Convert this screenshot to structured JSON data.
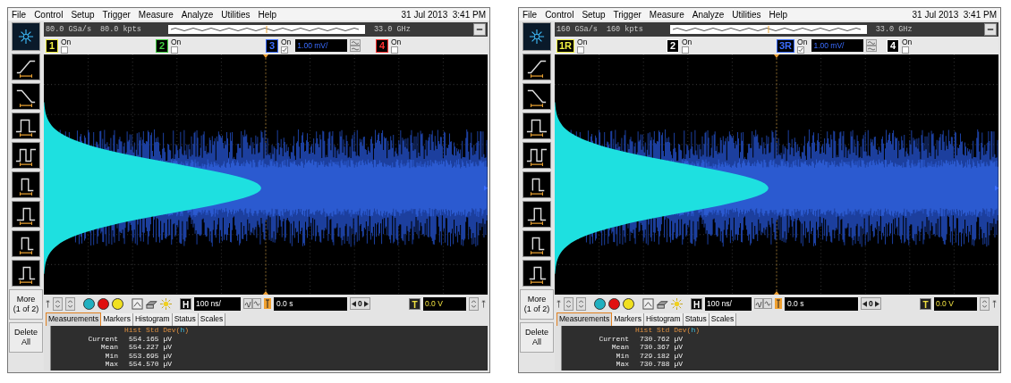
{
  "scopes": [
    {
      "menu": [
        "File",
        "Control",
        "Setup",
        "Trigger",
        "Measure",
        "Analyze",
        "Utilities",
        "Help"
      ],
      "datetime": "31 Jul 2013  3:41 PM",
      "sample_rate": "80.0 GSa/s",
      "memory": "80.0 kpts",
      "bandwidth": "33.0 GHz",
      "channels": [
        {
          "label": "1",
          "status": "On",
          "checked": false,
          "color": "#f0f040"
        },
        {
          "label": "2",
          "status": "On",
          "checked": false,
          "color": "#40d040"
        },
        {
          "label": "3",
          "status": "On",
          "checked": true,
          "color": "#3a6cff",
          "scale": "1.00 mV/"
        },
        {
          "label": "4",
          "status": "On",
          "checked": false,
          "color": "#ff3030"
        }
      ],
      "horizontal_label": "H",
      "timebase": "100 ns/",
      "delay": "0.0 s",
      "nav": "0",
      "trigger_label": "T",
      "trigger_level": "0.0 V",
      "more_button": {
        "label": "More",
        "sub": "(1 of 2)"
      },
      "delete_button": "Delete All",
      "tabs": [
        {
          "label": "Measurements",
          "selected": true
        },
        {
          "label": "Markers",
          "selected": false
        },
        {
          "label": "Histogram",
          "selected": false
        },
        {
          "label": "Status",
          "selected": false
        },
        {
          "label": "Scales",
          "selected": false
        }
      ],
      "measurement": {
        "title": [
          "Hist Std Dev(",
          "h",
          ")"
        ],
        "rows": [
          {
            "label": "Current",
            "value": "554.165 µV"
          },
          {
            "label": "Mean",
            "value": "554.227 µV"
          },
          {
            "label": "Min",
            "value": "553.695 µV"
          },
          {
            "label": "Max",
            "value": "554.570 µV"
          }
        ]
      }
    },
    {
      "menu": [
        "File",
        "Control",
        "Setup",
        "Trigger",
        "Measure",
        "Analyze",
        "Utilities",
        "Help"
      ],
      "datetime": "31 Jul 2013  3:41 PM",
      "sample_rate": "160 GSa/s",
      "memory": "160 kpts",
      "bandwidth": "33.0 GHz",
      "channels": [
        {
          "label": "1R",
          "status": "On",
          "checked": false,
          "color": "#f0f040"
        },
        {
          "label": "2",
          "status": "On",
          "checked": false,
          "color": "#ffffff"
        },
        {
          "label": "3R",
          "status": "On",
          "checked": true,
          "color": "#3a6cff",
          "scale": "1.00 mV/"
        },
        {
          "label": "4",
          "status": "On",
          "checked": false,
          "color": "#ffffff"
        }
      ],
      "horizontal_label": "H",
      "timebase": "100 ns/",
      "delay": "0.0 s",
      "nav": "0",
      "trigger_label": "T",
      "trigger_level": "0.0 V",
      "more_button": {
        "label": "More",
        "sub": "(1 of 2)"
      },
      "delete_button": "Delete All",
      "tabs": [
        {
          "label": "Measurements",
          "selected": true
        },
        {
          "label": "Markers",
          "selected": false
        },
        {
          "label": "Histogram",
          "selected": false
        },
        {
          "label": "Status",
          "selected": false
        },
        {
          "label": "Scales",
          "selected": false
        }
      ],
      "measurement": {
        "title": [
          "Hist Std Dev(",
          "h",
          ")"
        ],
        "rows": [
          {
            "label": "Current",
            "value": "730.762 µV"
          },
          {
            "label": "Mean",
            "value": "730.367 µV"
          },
          {
            "label": "Min",
            "value": "729.182 µV"
          },
          {
            "label": "Max",
            "value": "730.788 µV"
          }
        ]
      }
    }
  ]
}
